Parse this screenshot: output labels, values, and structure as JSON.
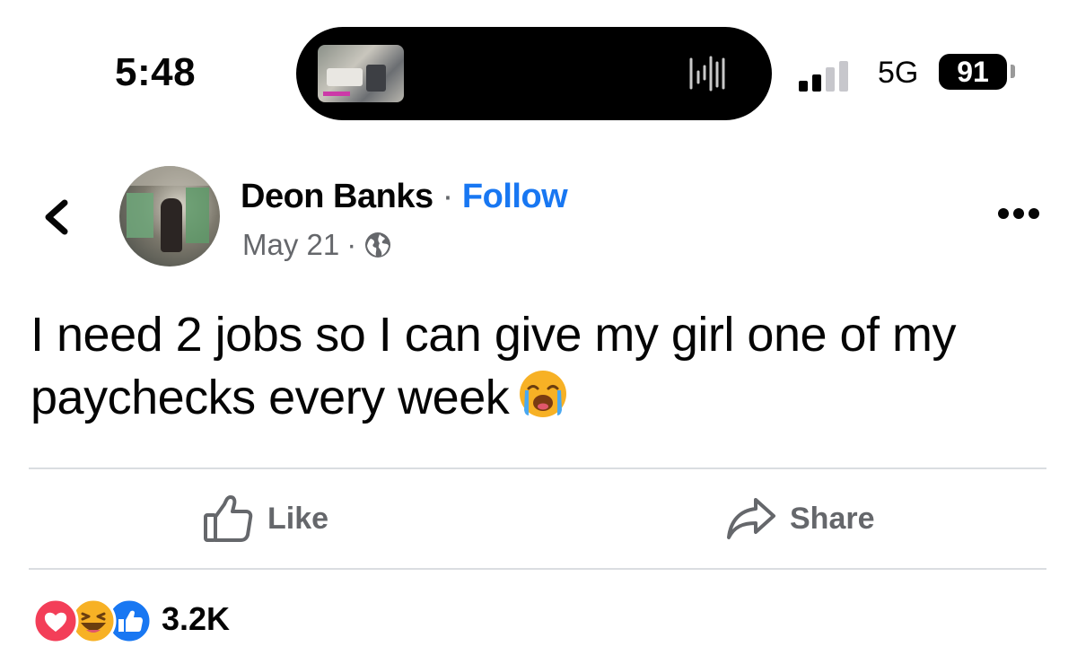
{
  "status_bar": {
    "time": "5:48",
    "network": "5G",
    "battery": "91"
  },
  "post": {
    "author": "Deon Banks",
    "separator": " · ",
    "follow_label": "Follow",
    "date": "May 21",
    "date_separator": "·",
    "audience_icon": "globe-icon",
    "text": "I need 2 jobs so I can give my girl one of my paychecks every week",
    "text_emoji": "loudly-crying-face-icon"
  },
  "actions": {
    "like_label": "Like",
    "share_label": "Share"
  },
  "reactions": {
    "icons": [
      "love-reaction-icon",
      "haha-reaction-icon",
      "like-reaction-icon"
    ],
    "count": "3.2K"
  },
  "colors": {
    "accent": "#1877f2",
    "secondary_text": "#65676b",
    "divider": "#dadde1",
    "love": "#f33e58",
    "haha": "#f7b125"
  }
}
